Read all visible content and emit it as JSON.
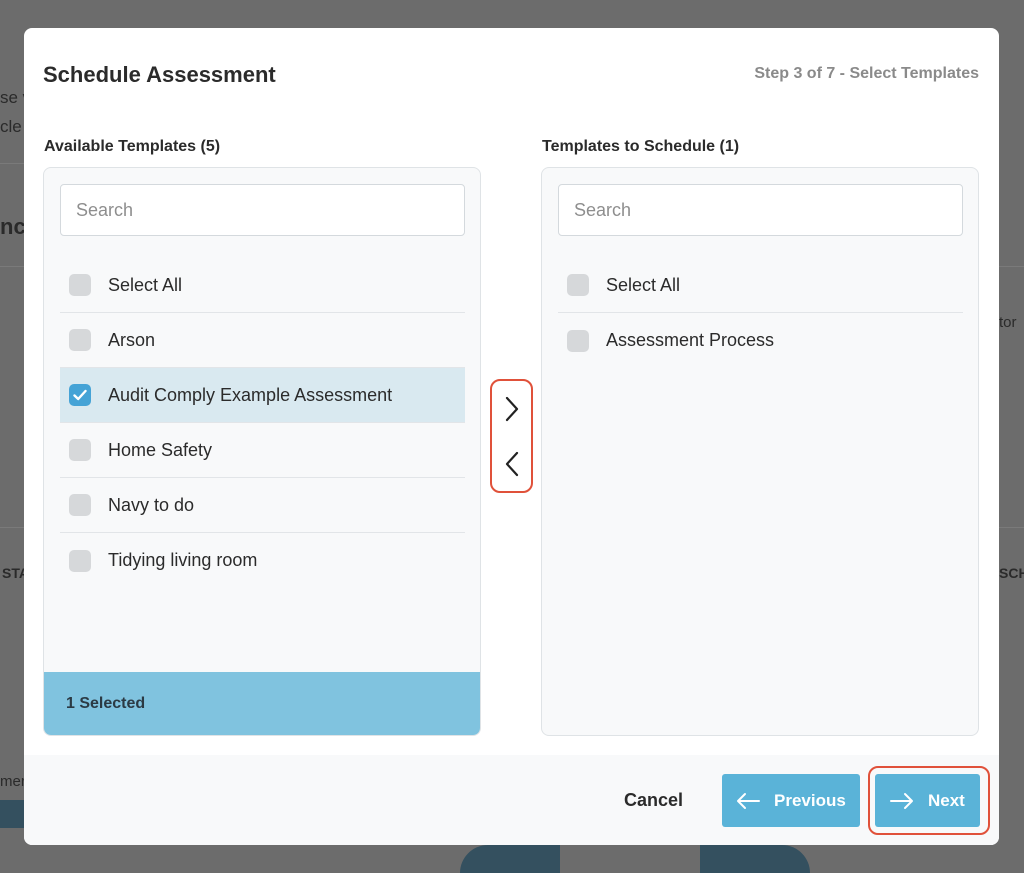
{
  "background": {
    "fragments": [
      "se v",
      "cle",
      "nc",
      "tor",
      "STA",
      "SCH",
      "mer"
    ]
  },
  "modal": {
    "title": "Schedule Assessment",
    "step": "Step 3 of 7 - Select Templates"
  },
  "available": {
    "title": "Available Templates (5)",
    "search_placeholder": "Search",
    "select_all_label": "Select All",
    "items": [
      {
        "label": "Arson",
        "checked": false
      },
      {
        "label": "Audit Comply Example Assessment",
        "checked": true
      },
      {
        "label": "Home Safety",
        "checked": false
      },
      {
        "label": "Navy to do",
        "checked": false
      },
      {
        "label": "Tidying living room",
        "checked": false
      }
    ],
    "footer": "1 Selected"
  },
  "schedule": {
    "title": "Templates to Schedule (1)",
    "search_placeholder": "Search",
    "select_all_label": "Select All",
    "items": [
      {
        "label": "Assessment Process",
        "checked": false
      }
    ]
  },
  "footer": {
    "cancel_label": "Cancel",
    "previous_label": "Previous",
    "next_label": "Next"
  },
  "colors": {
    "accent": "#5ab3d8",
    "selected_footer": "#80c3df",
    "selected_row": "#d9e9f0",
    "highlight_outline": "#e0513a"
  },
  "icons": {
    "move_right": "chevron-right-icon",
    "move_left": "chevron-left-icon",
    "previous": "arrow-left-icon",
    "next": "arrow-right-icon",
    "checked": "checkmark-icon"
  }
}
